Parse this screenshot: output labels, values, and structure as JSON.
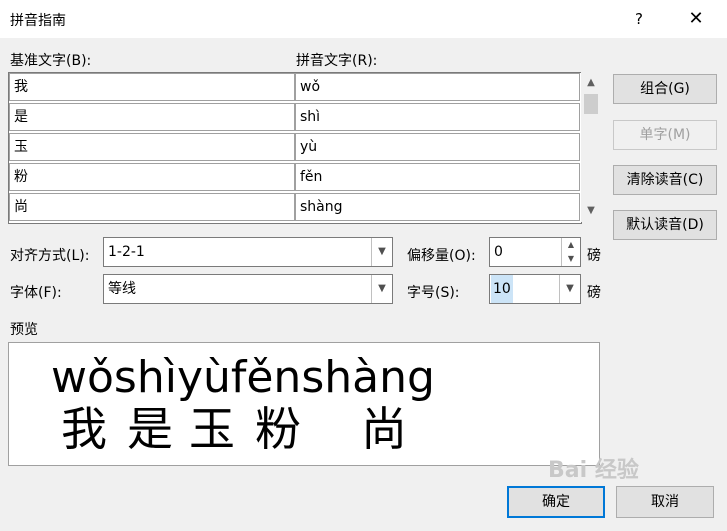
{
  "window": {
    "title": "拼音指南",
    "help": "?",
    "close": "✕"
  },
  "labels": {
    "base_text": "基准文字(B):",
    "pinyin_text": "拼音文字(R):",
    "align": "对齐方式(L):",
    "font": "字体(F):",
    "offset": "偏移量(O):",
    "size": "字号(S):",
    "preview": "预览",
    "unit1": "磅",
    "unit2": "磅"
  },
  "rows": [
    {
      "base": "我",
      "pinyin": "wǒ"
    },
    {
      "base": "是",
      "pinyin": "shì"
    },
    {
      "base": "玉",
      "pinyin": "yù"
    },
    {
      "base": "粉",
      "pinyin": "fěn"
    },
    {
      "base": "尚",
      "pinyin": "shàng"
    }
  ],
  "buttons": {
    "group": "组合(G)",
    "single": "单字(M)",
    "clear": "清除读音(C)",
    "default": "默认读音(D)",
    "ok": "确定",
    "cancel": "取消"
  },
  "fields": {
    "align_value": "1-2-1",
    "font_value": "等线",
    "offset_value": "0",
    "size_value": "10"
  },
  "preview": {
    "pinyin": "wǒshìyùfěnshàng",
    "chars": [
      "我",
      "是",
      "玉",
      "粉",
      "尚"
    ]
  },
  "watermark": "Bai 经验"
}
